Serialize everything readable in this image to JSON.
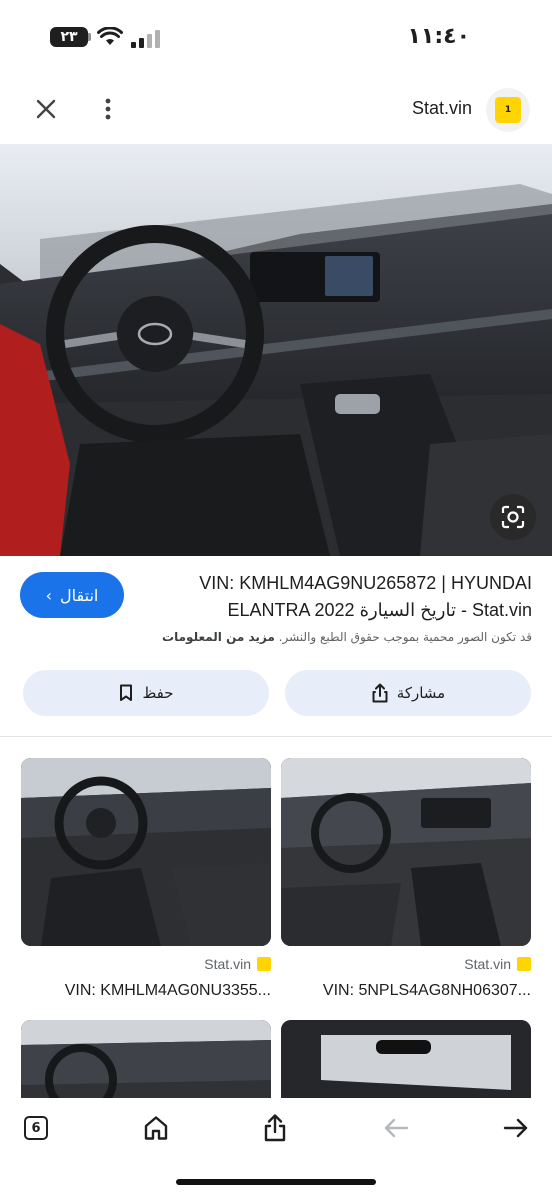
{
  "status_bar": {
    "battery": "٢٣",
    "time": "١١:٤٠"
  },
  "top_bar": {
    "site_name": "Stat.vin",
    "logo_text": "1"
  },
  "result": {
    "visit_label": "انتقال",
    "title": "VIN: KMHLM4AG9NU265872 | HYUNDAI ELANTRA 2022 تاريخ السيارة - Stat.vin",
    "copyright_notice": "قد تكون الصور محمية بموجب حقوق الطبع والنشر.",
    "more_info": "مزيد من المعلومات",
    "save_label": "حفظ",
    "share_label": "مشاركة"
  },
  "related": [
    {
      "source": "Stat.vin",
      "title": "VIN: KMHLM4AG0NU3355..."
    },
    {
      "source": "Stat.vin",
      "title": "VIN: 5NPLS4AG8NH06307..."
    }
  ],
  "bottom_bar": {
    "tabs_count": "6"
  },
  "colors": {
    "accent": "#1a73e8",
    "button_bg": "#e8eef9",
    "brand_yellow": "#ffd400"
  }
}
